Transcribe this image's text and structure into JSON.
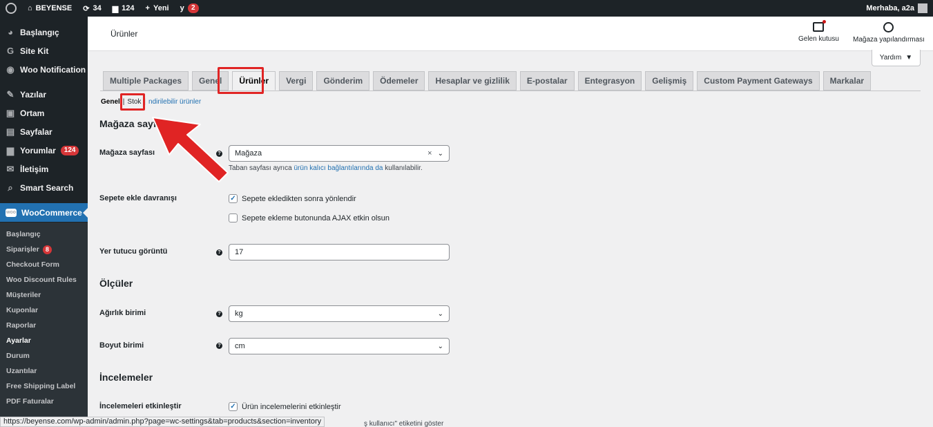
{
  "adminbar": {
    "site": "BEYENSE",
    "updates": "34",
    "comments": "124",
    "new": "Yeni",
    "yoast_badge": "2",
    "greeting": "Merhaba, a2a"
  },
  "sidebar": {
    "items": [
      {
        "label": "Başlangıç",
        "icon": "dashboard-icon"
      },
      {
        "label": "Site Kit",
        "icon": "sitekit-icon"
      },
      {
        "label": "Woo Notification",
        "icon": "notification-icon"
      },
      {
        "label": "Yazılar",
        "icon": "pin-icon"
      },
      {
        "label": "Ortam",
        "icon": "media-icon"
      },
      {
        "label": "Sayfalar",
        "icon": "page-icon"
      },
      {
        "label": "Yorumlar",
        "icon": "comment-icon",
        "badge": "124"
      },
      {
        "label": "İletişim",
        "icon": "mail-icon"
      },
      {
        "label": "Smart Search",
        "icon": "search-icon"
      },
      {
        "label": "WooCommerce",
        "icon": "woo-icon"
      }
    ],
    "submenu": [
      {
        "label": "Başlangıç"
      },
      {
        "label": "Siparişler",
        "badge": "8"
      },
      {
        "label": "Checkout Form"
      },
      {
        "label": "Woo Discount Rules"
      },
      {
        "label": "Müşteriler"
      },
      {
        "label": "Kuponlar"
      },
      {
        "label": "Raporlar"
      },
      {
        "label": "Ayarlar"
      },
      {
        "label": "Durum"
      },
      {
        "label": "Uzantılar"
      },
      {
        "label": "Free Shipping Label"
      },
      {
        "label": "PDF Faturalar"
      }
    ]
  },
  "header": {
    "title": "Ürünler",
    "inbox": "Gelen kutusu",
    "store_setup": "Mağaza yapılandırması",
    "help": "Yardım"
  },
  "tabs": [
    "Multiple Packages",
    "Genel",
    "Ürünler",
    "Vergi",
    "Gönderim",
    "Ödemeler",
    "Hesaplar ve gizlilik",
    "E-postalar",
    "Entegrasyon",
    "Gelişmiş",
    "Custom Payment Gateways",
    "Markalar"
  ],
  "subsub": {
    "general": "Genel",
    "stock": "Stok",
    "sep": "|",
    "downloadable": "ndirilebilir ürünler"
  },
  "form": {
    "shop_section": "Mağaza sayfası",
    "shop_page_label": "Mağaza sayfası",
    "shop_page_value": "Mağaza",
    "shop_desc_pre": "Taban sayfası ayrıca ",
    "shop_desc_link": "ürün kalıcı bağlantılarında da",
    "shop_desc_post": " kullanılabilir.",
    "add_to_cart_label": "Sepete ekle davranışı",
    "redirect_label": "Sepete ekledikten sonra yönlendir",
    "ajax_label": "Sepete ekleme butonunda AJAX etkin olsun",
    "placeholder_label": "Yer tutucu görüntü",
    "placeholder_value": "17",
    "measures_section": "Ölçüler",
    "weight_label": "Ağırlık birimi",
    "weight_value": "kg",
    "dimension_label": "Boyut birimi",
    "dimension_value": "cm",
    "reviews_section": "İncelemeler",
    "enable_reviews_label": "İncelemeleri etkinleştir",
    "enable_reviews_value": "Ürün incelemelerini etkinleştir",
    "truncated_text": "ş kullanıcı\" etiketini göster"
  },
  "statusbar": "https://beyense.com/wp-admin/admin.php?page=wc-settings&tab=products&section=inventory"
}
